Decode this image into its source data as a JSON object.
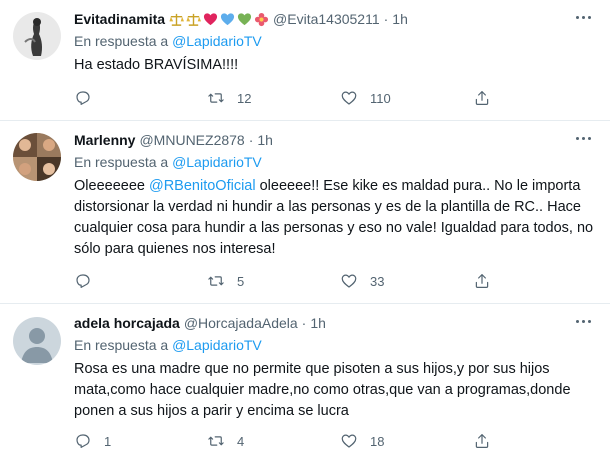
{
  "tweets": [
    {
      "display_name": "Evitadinamita",
      "handle": "@Evita14305211",
      "time": "1h",
      "emoji": [
        "scale-emoji",
        "scale-emoji",
        "red-heart-emoji",
        "blue-heart-emoji",
        "green-heart-emoji",
        "flower-emoji"
      ],
      "reply_prefix": "En respuesta a",
      "reply_to": "@LapidarioTV",
      "text": "Ha estado BRAVÍSIMA!!!!",
      "reply_count": "",
      "retweet_count": "12",
      "like_count": "110"
    },
    {
      "display_name": "Marlenny",
      "handle": "@MNUNEZ2878",
      "time": "1h",
      "reply_prefix": "En respuesta a",
      "reply_to": "@LapidarioTV",
      "text_before": "Oleeeeeee ",
      "text_mention": "@RBenitoOficial",
      "text_after": " oleeeee!! Ese kike es maldad pura.. No le importa distorsionar la verdad ni hundir a las personas y es de la plantilla de RC.. Hace cualquier cosa para hundir a las personas y eso no vale! Igualdad para todos, no sólo para quienes nos interesa!",
      "reply_count": "",
      "retweet_count": "5",
      "like_count": "33"
    },
    {
      "display_name": "adela horcajada",
      "handle": "@HorcajadaAdela",
      "time": "1h",
      "reply_prefix": "En respuesta a",
      "reply_to": "@LapidarioTV",
      "text": "Rosa es una madre que no permite que pisoten a sus hijos,y por sus hijos mata,como hace cualquier madre,no como otras,que van a programas,donde  ponen a sus hijos a parir y encima se lucra",
      "reply_count": "1",
      "retweet_count": "4",
      "like_count": "18"
    }
  ],
  "colors": {
    "link": "#1d9bf0",
    "secondary_text": "#536471",
    "primary_text": "#0f1419",
    "divider": "#e6ecf0"
  }
}
